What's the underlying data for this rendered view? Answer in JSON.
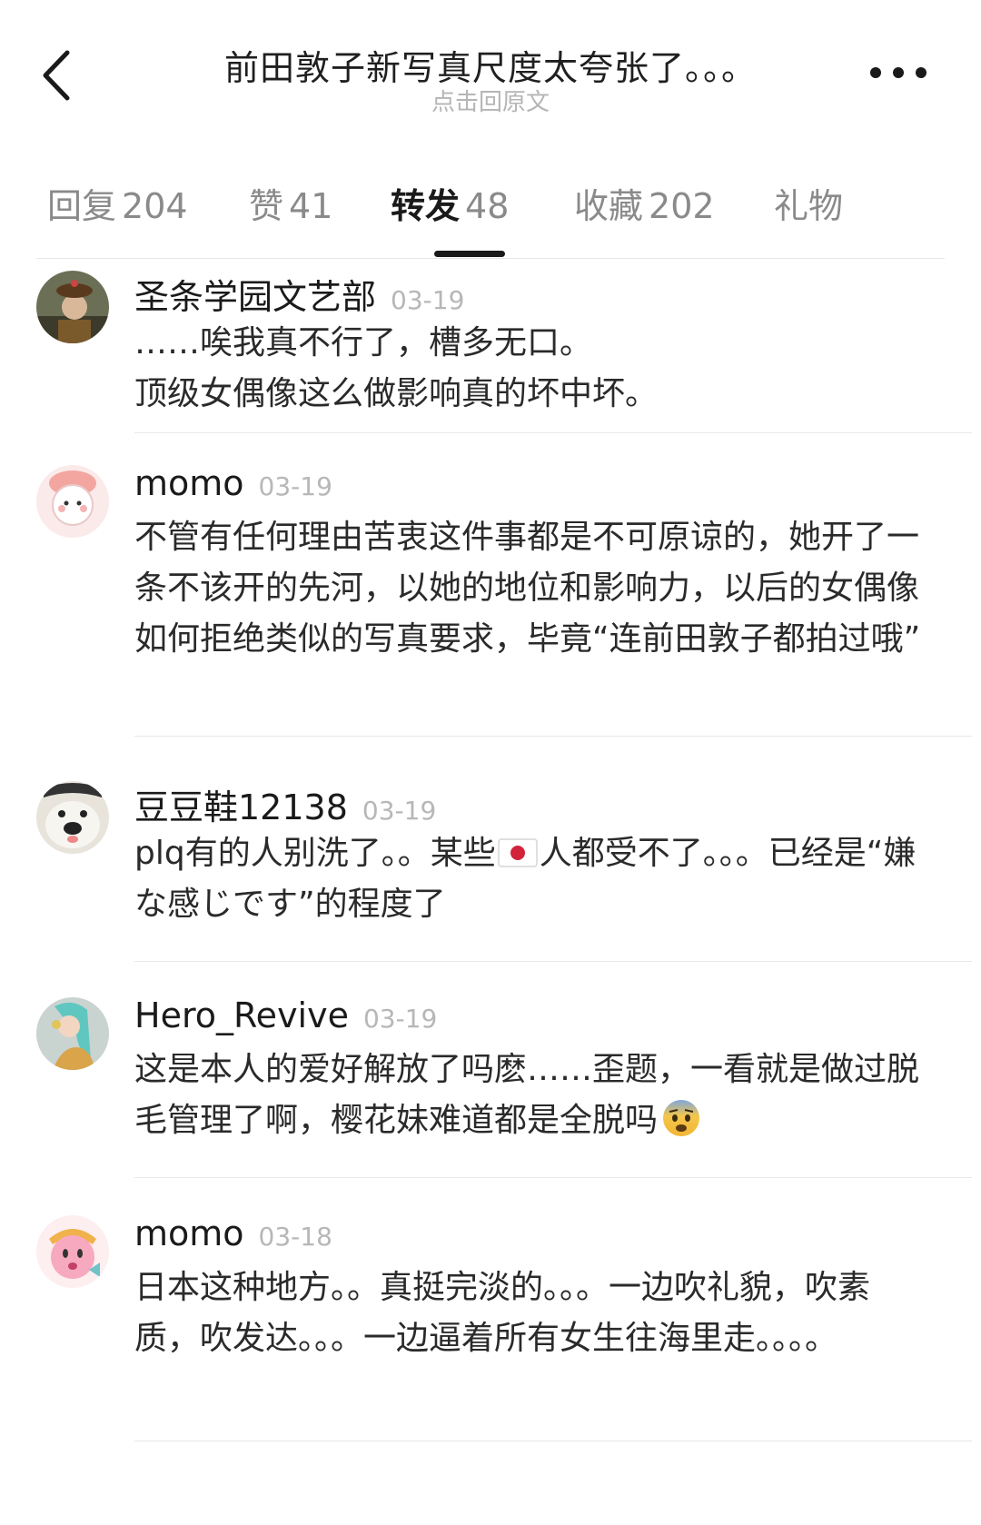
{
  "header": {
    "title": "前田敦子新写真尺度太夸张了。。。",
    "subtitle": "点击回原文"
  },
  "tabs": [
    {
      "label": "回复",
      "count": "204"
    },
    {
      "label": "赞",
      "count": "41"
    },
    {
      "label": "转发",
      "count": "48",
      "active": true
    },
    {
      "label": "收藏",
      "count": "202"
    },
    {
      "label": "礼物",
      "count": ""
    }
  ],
  "comments": [
    {
      "name": "圣条学园文艺部",
      "date": "03-19",
      "text_a": "……唉我真不行了，槽多无口。",
      "text_b": "顶级女偶像这么做影响真的坏中坏。",
      "avatar": "portrait-avatar"
    },
    {
      "name": "momo",
      "date": "03-19",
      "text_a": "不管有任何理由苦衷这件事都是不可原谅的，她开了一条不该开的先河，以她的地位和影响力，以后的女偶像如何拒绝类似的写真要求，毕竟“连前田敦子都拍过哦”",
      "avatar": "cartoon-avatar"
    },
    {
      "name": "豆豆鞋12138",
      "date": "03-19",
      "text_a": "plq有的人别洗了。。某些",
      "flag": "japan-flag-icon",
      "text_b": "人都受不了。。。已经是“嫌な感じです”的程度了",
      "avatar": "dog-avatar"
    },
    {
      "name": "Hero_Revive",
      "date": "03-19",
      "text_a": "这是本人的爱好解放了吗麽……歪题，一看就是做过脱毛管理了啊，樱花妹难道都是全脱吗",
      "emoji": "fearful-face-emoji",
      "avatar": "anime-avatar"
    },
    {
      "name": "momo",
      "date": "03-18",
      "text_a": "日本这种地方。。真挺完淡的。。。一边吹礼貌，吹素质，吹发达。。。一边逼着所有女生往海里走。。。。",
      "avatar": "kirby-avatar"
    }
  ],
  "colors": {
    "text_primary": "#1a1a1a",
    "text_secondary": "#8a8a8a",
    "date_gray": "#b7b7b7",
    "divider": "#e8e8e8"
  }
}
